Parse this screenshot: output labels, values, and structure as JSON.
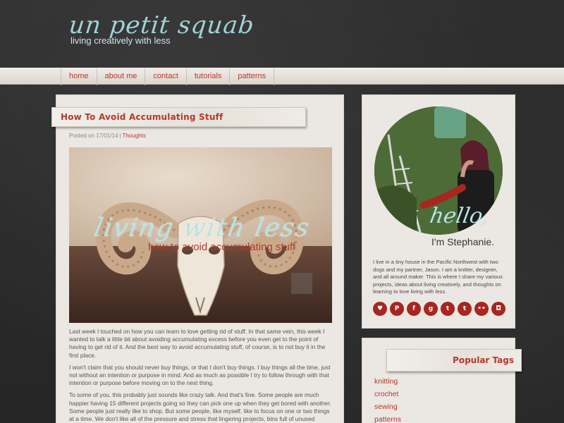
{
  "site": {
    "logo_script": "un petit squab",
    "tagline": "living creatively with less"
  },
  "nav": {
    "items": [
      {
        "label": "home"
      },
      {
        "label": "about me"
      },
      {
        "label": "contact"
      },
      {
        "label": "tutorials"
      },
      {
        "label": "patterns"
      }
    ]
  },
  "post": {
    "title": "How To Avoid Accumulating Stuff",
    "meta_prefix": "Posted on 17/01/14",
    "meta_sep": "|",
    "category": "Thoughts",
    "hero_script": "living with less",
    "hero_sub": "how to avoid accumulating stuff",
    "paragraphs": [
      "Last week I touched on how you can learn to love getting rid of stuff. In that same vein, this week I wanted to talk a little bit about avoiding accumulating excess before you even get to the point of having to get rid of it. And the best way to avoid accumulating stuff, of course, is to not buy  it in the first place.",
      "I won't claim that you should never buy things, or that I don't buy things. I buy things all the time, just not without an intention or purpose in mind. And as much as possible I try to follow through with that intention or purpose before moving on to the next thing.",
      "To some of you, this probably just sounds like crazy talk. And that's fine. Some people are much happier having 15 different projects going so they can pick one up when they get bored with another.  Some people just really like to shop. But some people, like myself, like to focus on one or two things at a time.  We don't like all of the pressure and stress that lingering projects, bins full of unused supplies, and space being taken up by junk causes."
    ]
  },
  "about": {
    "hello_script": "hello,",
    "name": "I'm Stephanie.",
    "text": "I live in a tiny house in the Pacific Northwest with two dogs and my partner, Jason. I am a knitter, designer, and all around maker. This is where I share my various projects, ideas about living creatively, and thoughts on learning to love living with less.",
    "social": [
      {
        "icon": "heart-icon",
        "glyph": "♥"
      },
      {
        "icon": "pinterest-icon",
        "glyph": "P"
      },
      {
        "icon": "facebook-icon",
        "glyph": "f"
      },
      {
        "icon": "google-plus-icon",
        "glyph": "g"
      },
      {
        "icon": "twitter-icon",
        "glyph": "t"
      },
      {
        "icon": "tumblr-icon",
        "glyph": "t"
      },
      {
        "icon": "flickr-icon",
        "glyph": "••"
      },
      {
        "icon": "instagram-icon",
        "glyph": "◘"
      }
    ]
  },
  "tags": {
    "title": "Popular Tags",
    "items": [
      "knitting",
      "crochet",
      "sewing",
      "patterns"
    ]
  },
  "colors": {
    "accent": "#b33a2c",
    "script_blue": "#a8d6dc",
    "background": "#2b2b2b",
    "card": "#ebe7e2"
  }
}
